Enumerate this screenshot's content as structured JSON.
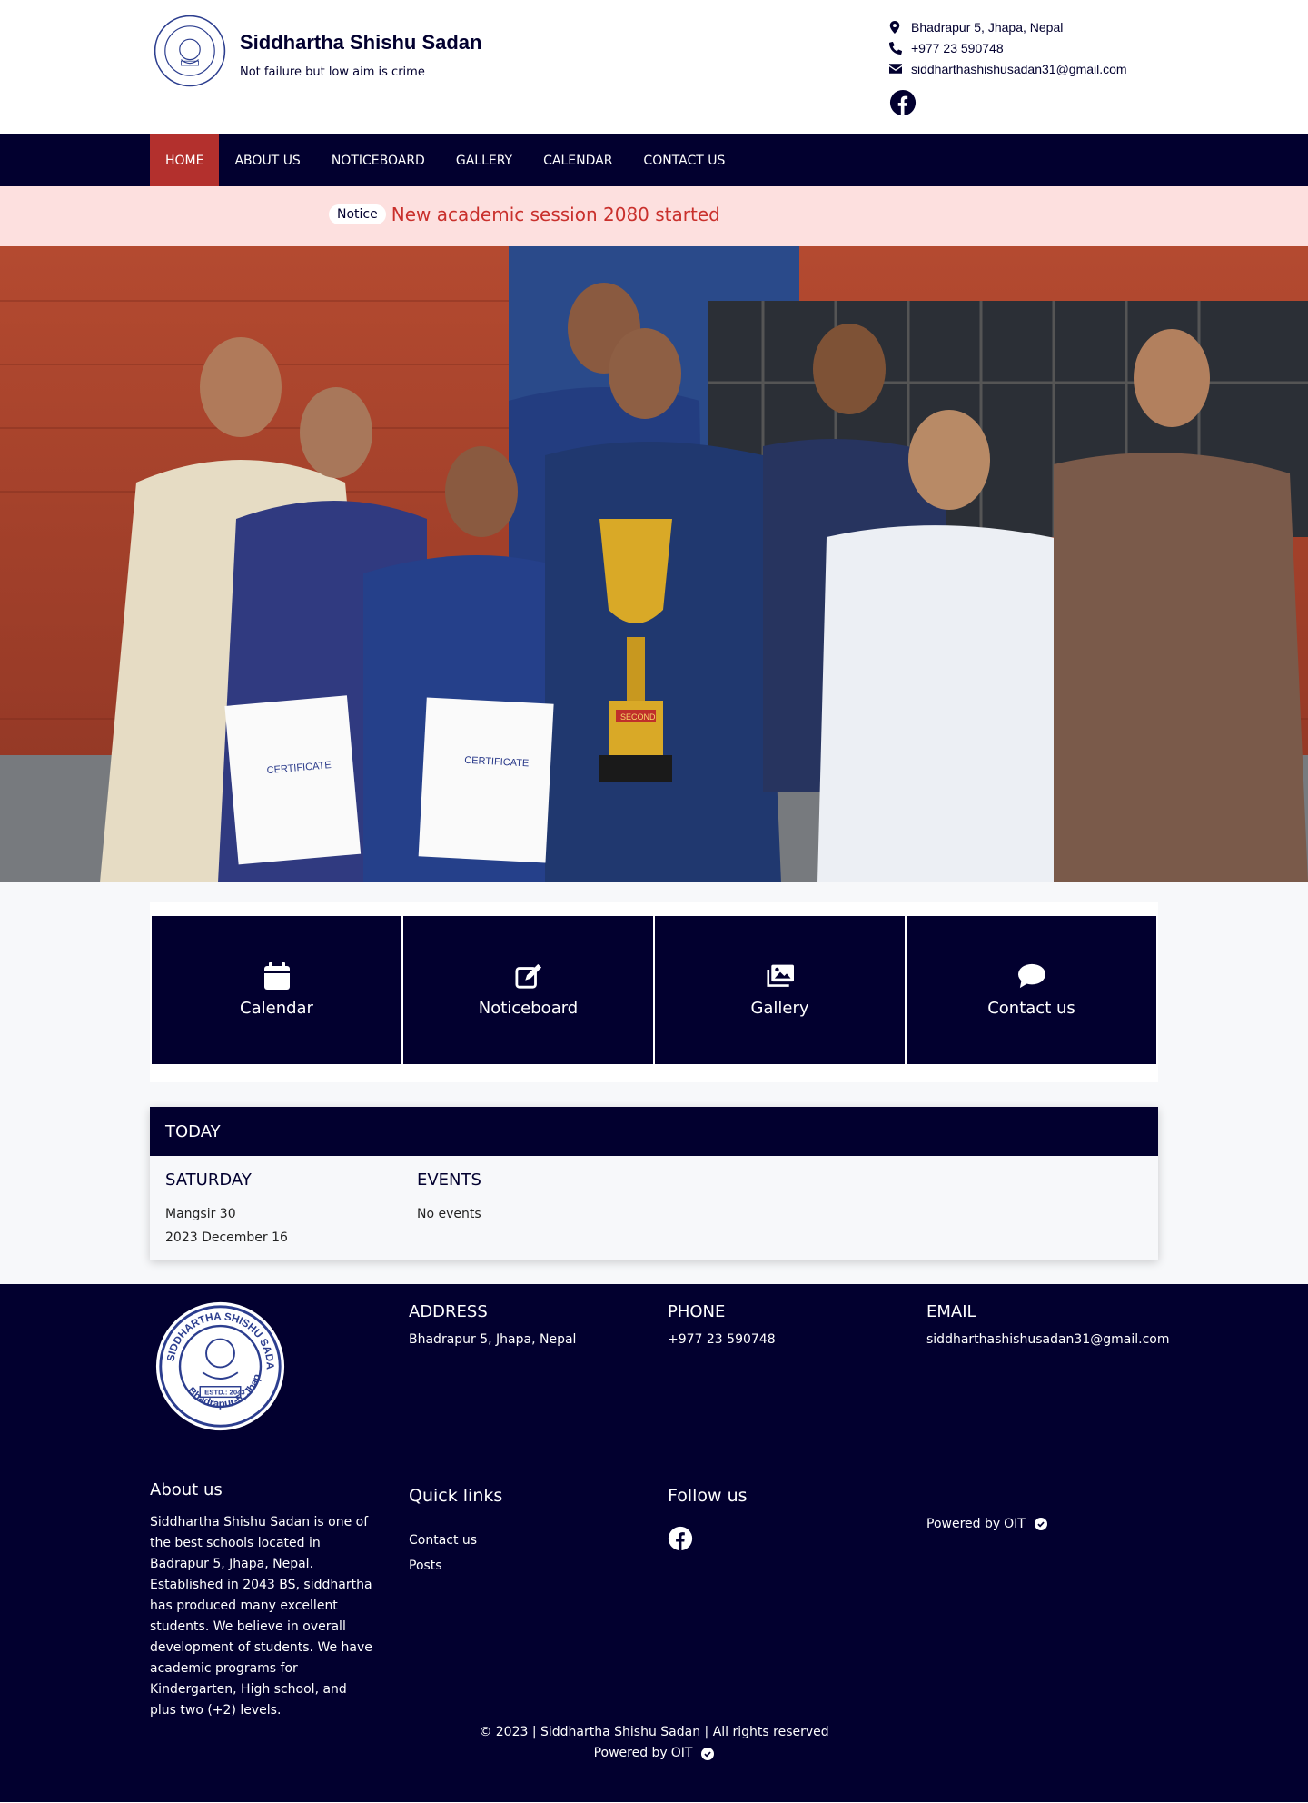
{
  "header": {
    "school_name": "Siddhartha Shishu Sadan",
    "tagline": "Not failure but low aim is crime",
    "address": "Bhadrapur 5, Jhapa, Nepal",
    "phone": "+977 23 590748",
    "email": "siddharthashishusadan31@gmail.com",
    "logo_text": "SIDDHARTHA SHISHU SADAN",
    "logo_estd": "ESTD.: 2043",
    "logo_place": "Bhadrapur-5, Jhapa"
  },
  "nav": {
    "items": [
      "HOME",
      "ABOUT US",
      "NOTICEBOARD",
      "GALLERY",
      "CALENDAR",
      "CONTACT US"
    ],
    "active": "HOME"
  },
  "notice": {
    "badge": "Notice",
    "text": "New academic session 2080 started"
  },
  "hero": {
    "certificate_label": "CERTIFICATE",
    "trophy_label": "SECOND"
  },
  "features": [
    {
      "label": "Calendar",
      "icon": "calendar-icon"
    },
    {
      "label": "Noticeboard",
      "icon": "edit-icon"
    },
    {
      "label": "Gallery",
      "icon": "images-icon"
    },
    {
      "label": "Contact us",
      "icon": "comment-icon"
    }
  ],
  "today": {
    "title": "TODAY",
    "day": "SATURDAY",
    "nepali_date": "Mangsir 30",
    "english_date": "2023 December 16",
    "events_title": "EVENTS",
    "events_text": "No events"
  },
  "footer": {
    "address_title": "ADDRESS",
    "address": "Bhadrapur 5, Jhapa, Nepal",
    "phone_title": "PHONE",
    "phone": "+977 23 590748",
    "email_title": "EMAIL",
    "email": "siddharthashishusadan31@gmail.com",
    "about_title": "About us",
    "about_text": "Siddhartha Shishu Sadan is one of the best schools located in Badrapur 5, Jhapa, Nepal. Established in 2043 BS, siddhartha has produced many excellent students. We believe in overall development of students. We have academic programs for Kindergarten, High school, and plus two (+2) levels.",
    "quick_links_title": "Quick links",
    "quick_links": [
      "Contact us",
      "Posts"
    ],
    "follow_title": "Follow us",
    "powered_prefix": "Powered by",
    "powered_link": "OIT",
    "copyright": "© 2023 | Siddhartha Shishu Sadan | All rights reserved"
  },
  "colors": {
    "navy": "#02002f",
    "accent_red": "#b3302d",
    "notice_bg": "#fde0df",
    "notice_text": "#c9302c"
  }
}
